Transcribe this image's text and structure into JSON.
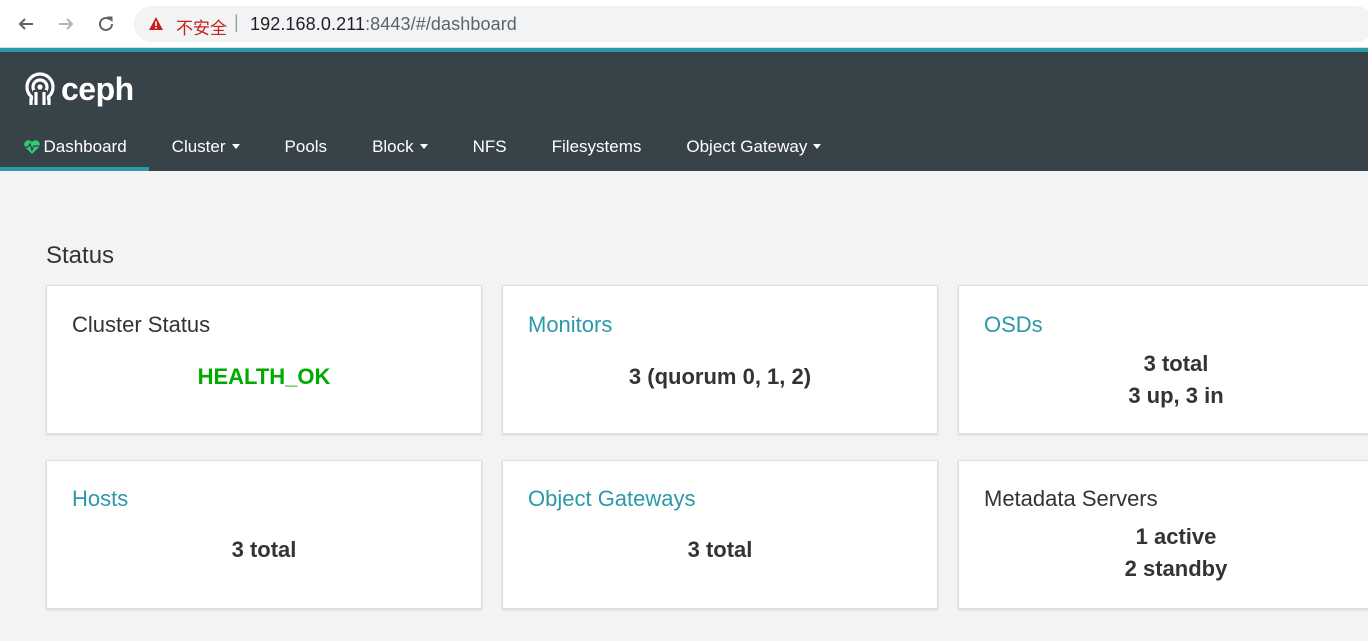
{
  "browser": {
    "insecure_label": "不安全",
    "separator": "|",
    "url_host": "192.168.0.211",
    "url_path": ":8443/#/dashboard"
  },
  "navbar": {
    "brand": "ceph",
    "items": [
      {
        "label": "Dashboard",
        "active": true,
        "dropdown": false
      },
      {
        "label": "Cluster",
        "active": false,
        "dropdown": true
      },
      {
        "label": "Pools",
        "active": false,
        "dropdown": false
      },
      {
        "label": "Block",
        "active": false,
        "dropdown": true
      },
      {
        "label": "NFS",
        "active": false,
        "dropdown": false
      },
      {
        "label": "Filesystems",
        "active": false,
        "dropdown": false
      },
      {
        "label": "Object Gateway",
        "active": false,
        "dropdown": true
      }
    ]
  },
  "status": {
    "title": "Status",
    "cards": {
      "cluster_status": {
        "title": "Cluster Status",
        "value": "HEALTH_OK"
      },
      "monitors": {
        "title": "Monitors",
        "value": "3 (quorum 0, 1, 2)"
      },
      "osds": {
        "title": "OSDs",
        "line1": "3 total",
        "line2": "3 up, 3 in"
      },
      "hosts": {
        "title": "Hosts",
        "value": "3 total"
      },
      "object_gateways": {
        "title": "Object Gateways",
        "value": "3 total"
      },
      "metadata_servers": {
        "title": "Metadata Servers",
        "line1": "1 active",
        "line2": "2 standby"
      }
    }
  },
  "colors": {
    "navbar_bg": "#374249",
    "accent": "#2b99a8",
    "health_ok": "#00aa00",
    "page_bg": "#f3f3f3"
  }
}
